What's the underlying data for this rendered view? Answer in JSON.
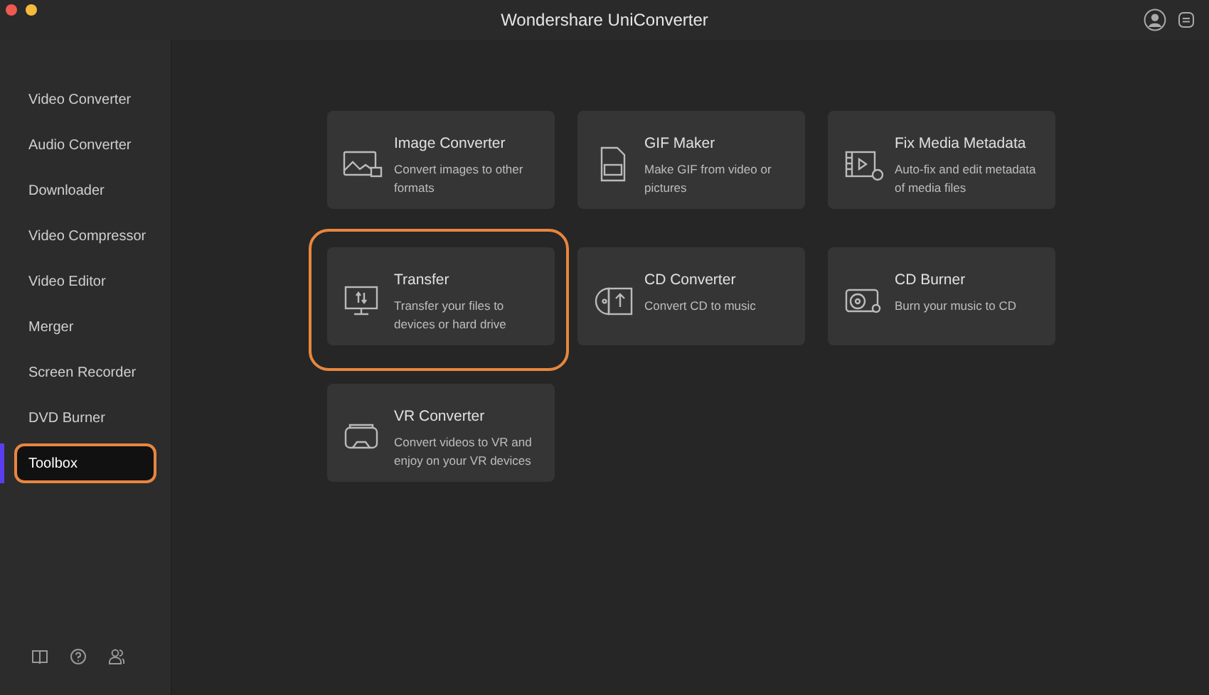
{
  "window": {
    "title": "Wondershare UniConverter"
  },
  "sidebar": {
    "items": [
      {
        "label": "Video Converter",
        "selected": false,
        "highlighted": false
      },
      {
        "label": "Audio Converter",
        "selected": false,
        "highlighted": false
      },
      {
        "label": "Downloader",
        "selected": false,
        "highlighted": false
      },
      {
        "label": "Video Compressor",
        "selected": false,
        "highlighted": false
      },
      {
        "label": "Video Editor",
        "selected": false,
        "highlighted": false
      },
      {
        "label": "Merger",
        "selected": false,
        "highlighted": false
      },
      {
        "label": "Screen Recorder",
        "selected": false,
        "highlighted": false
      },
      {
        "label": "DVD Burner",
        "selected": false,
        "highlighted": false
      },
      {
        "label": "Toolbox",
        "selected": true,
        "highlighted": true
      }
    ]
  },
  "tools": [
    {
      "kind": "image",
      "title": "Image Converter",
      "description": "Convert images to other formats",
      "highlighted": false
    },
    {
      "kind": "gif",
      "title": "GIF Maker",
      "description": "Make GIF from video or pictures",
      "highlighted": false
    },
    {
      "kind": "metadata",
      "title": "Fix Media Metadata",
      "description": "Auto-fix and edit metadata of media files",
      "highlighted": false
    },
    {
      "kind": "transfer",
      "title": "Transfer",
      "description": "Transfer your files to devices or hard drive",
      "highlighted": true
    },
    {
      "kind": "cd-convert",
      "title": "CD Converter",
      "description": "Convert CD to music",
      "highlighted": false
    },
    {
      "kind": "cd-burn",
      "title": "CD Burner",
      "description": "Burn your music to CD",
      "highlighted": false
    },
    {
      "kind": "vr",
      "title": "VR Converter",
      "description": "Convert videos to VR and enjoy on your VR devices",
      "highlighted": false
    }
  ]
}
